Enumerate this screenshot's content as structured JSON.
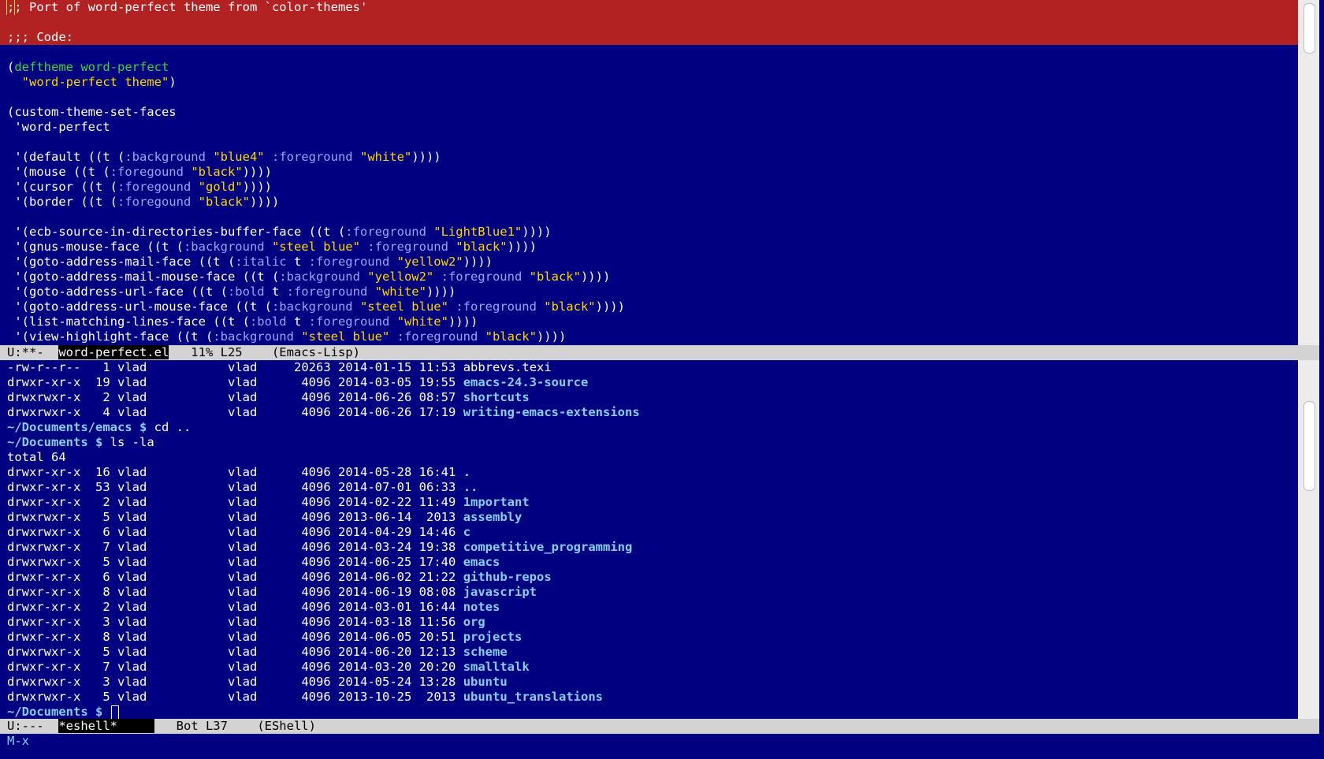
{
  "colors": {
    "background": "#000080",
    "highlight": "#b22222",
    "keyword": "#3cd33c",
    "string": "#ffd700",
    "keyword_arg": "#a0a0ff",
    "directory": "#87cefa",
    "modeline_bg": "#d3d3d3"
  },
  "top_window": {
    "highlighted": [
      [
        {
          "t": ";",
          "c": "cursor"
        },
        {
          "t": "; Port of word-perfect theme from `color-themes'",
          "c": "plain"
        }
      ],
      [],
      [
        {
          "t": ";;; Code:",
          "c": "plain"
        }
      ]
    ],
    "code": [
      [],
      [
        {
          "t": "(",
          "c": "plain"
        },
        {
          "t": "deftheme",
          "c": "kw"
        },
        {
          "t": " ",
          "c": "plain"
        },
        {
          "t": "word-perfect",
          "c": "fn"
        }
      ],
      [
        {
          "t": "  ",
          "c": "plain"
        },
        {
          "t": "\"word-perfect theme\"",
          "c": "str"
        },
        {
          "t": ")",
          "c": "plain"
        }
      ],
      [],
      [
        {
          "t": "(custom-theme-set-faces",
          "c": "plain"
        }
      ],
      [
        {
          "t": " 'word-perfect",
          "c": "plain"
        }
      ],
      [],
      [
        {
          "t": " '(default ((t (",
          "c": "plain"
        },
        {
          "t": ":background",
          "c": "key"
        },
        {
          "t": " ",
          "c": "plain"
        },
        {
          "t": "\"blue4\"",
          "c": "str"
        },
        {
          "t": " ",
          "c": "plain"
        },
        {
          "t": ":foreground",
          "c": "key"
        },
        {
          "t": " ",
          "c": "plain"
        },
        {
          "t": "\"white\"",
          "c": "str"
        },
        {
          "t": "))))",
          "c": "plain"
        }
      ],
      [
        {
          "t": " '(mouse ((t (",
          "c": "plain"
        },
        {
          "t": ":foregound",
          "c": "key"
        },
        {
          "t": " ",
          "c": "plain"
        },
        {
          "t": "\"black\"",
          "c": "str"
        },
        {
          "t": "))))",
          "c": "plain"
        }
      ],
      [
        {
          "t": " '(cursor ((t (",
          "c": "plain"
        },
        {
          "t": ":foregound",
          "c": "key"
        },
        {
          "t": " ",
          "c": "plain"
        },
        {
          "t": "\"gold\"",
          "c": "str"
        },
        {
          "t": "))))",
          "c": "plain"
        }
      ],
      [
        {
          "t": " '(border ((t (",
          "c": "plain"
        },
        {
          "t": ":foregound",
          "c": "key"
        },
        {
          "t": " ",
          "c": "plain"
        },
        {
          "t": "\"black\"",
          "c": "str"
        },
        {
          "t": "))))",
          "c": "plain"
        }
      ],
      [],
      [
        {
          "t": " '(ecb-source-in-directories-buffer-face ((t (",
          "c": "plain"
        },
        {
          "t": ":foreground",
          "c": "key"
        },
        {
          "t": " ",
          "c": "plain"
        },
        {
          "t": "\"LightBlue1\"",
          "c": "str"
        },
        {
          "t": "))))",
          "c": "plain"
        }
      ],
      [
        {
          "t": " '(gnus-mouse-face ((t (",
          "c": "plain"
        },
        {
          "t": ":background",
          "c": "key"
        },
        {
          "t": " ",
          "c": "plain"
        },
        {
          "t": "\"steel blue\"",
          "c": "str"
        },
        {
          "t": " ",
          "c": "plain"
        },
        {
          "t": ":foreground",
          "c": "key"
        },
        {
          "t": " ",
          "c": "plain"
        },
        {
          "t": "\"black\"",
          "c": "str"
        },
        {
          "t": "))))",
          "c": "plain"
        }
      ],
      [
        {
          "t": " '(goto-address-mail-face ((t (",
          "c": "plain"
        },
        {
          "t": ":italic",
          "c": "key"
        },
        {
          "t": " t ",
          "c": "plain"
        },
        {
          "t": ":foreground",
          "c": "key"
        },
        {
          "t": " ",
          "c": "plain"
        },
        {
          "t": "\"yellow2\"",
          "c": "str"
        },
        {
          "t": "))))",
          "c": "plain"
        }
      ],
      [
        {
          "t": " '(goto-address-mail-mouse-face ((t (",
          "c": "plain"
        },
        {
          "t": ":background",
          "c": "key"
        },
        {
          "t": " ",
          "c": "plain"
        },
        {
          "t": "\"yellow2\"",
          "c": "str"
        },
        {
          "t": " ",
          "c": "plain"
        },
        {
          "t": ":foreground",
          "c": "key"
        },
        {
          "t": " ",
          "c": "plain"
        },
        {
          "t": "\"black\"",
          "c": "str"
        },
        {
          "t": "))))",
          "c": "plain"
        }
      ],
      [
        {
          "t": " '(goto-address-url-face ((t (",
          "c": "plain"
        },
        {
          "t": ":bold",
          "c": "key"
        },
        {
          "t": " t ",
          "c": "plain"
        },
        {
          "t": ":foreground",
          "c": "key"
        },
        {
          "t": " ",
          "c": "plain"
        },
        {
          "t": "\"white\"",
          "c": "str"
        },
        {
          "t": "))))",
          "c": "plain"
        }
      ],
      [
        {
          "t": " '(goto-address-url-mouse-face ((t (",
          "c": "plain"
        },
        {
          "t": ":background",
          "c": "key"
        },
        {
          "t": " ",
          "c": "plain"
        },
        {
          "t": "\"steel blue\"",
          "c": "str"
        },
        {
          "t": " ",
          "c": "plain"
        },
        {
          "t": ":foreground",
          "c": "key"
        },
        {
          "t": " ",
          "c": "plain"
        },
        {
          "t": "\"black\"",
          "c": "str"
        },
        {
          "t": "))))",
          "c": "plain"
        }
      ],
      [
        {
          "t": " '(list-matching-lines-face ((t (",
          "c": "plain"
        },
        {
          "t": ":bold",
          "c": "key"
        },
        {
          "t": " t ",
          "c": "plain"
        },
        {
          "t": ":foreground",
          "c": "key"
        },
        {
          "t": " ",
          "c": "plain"
        },
        {
          "t": "\"white\"",
          "c": "str"
        },
        {
          "t": "))))",
          "c": "plain"
        }
      ],
      [
        {
          "t": " '(view-highlight-face ((t (",
          "c": "plain"
        },
        {
          "t": ":background",
          "c": "key"
        },
        {
          "t": " ",
          "c": "plain"
        },
        {
          "t": "\"steel blue\"",
          "c": "str"
        },
        {
          "t": " ",
          "c": "plain"
        },
        {
          "t": ":foreground",
          "c": "key"
        },
        {
          "t": " ",
          "c": "plain"
        },
        {
          "t": "\"black\"",
          "c": "str"
        },
        {
          "t": "))))",
          "c": "plain"
        }
      ]
    ]
  },
  "top_modeline": {
    "status": "U:**-  ",
    "buffer": "word-perfect.el",
    "position": "   11% L25    ",
    "mode": "(Emacs-Lisp)"
  },
  "bottom_window": {
    "lines": [
      {
        "perm": "-rw-r--r--",
        "links": "1",
        "owner": "vlad",
        "group": "vlad",
        "size": "20263",
        "date": "2014-01-15",
        "time": "11:53",
        "name": "abbrevs.texi",
        "is_dir": false
      },
      {
        "perm": "drwxr-xr-x",
        "links": "19",
        "owner": "vlad",
        "group": "vlad",
        "size": "4096",
        "date": "2014-03-05",
        "time": "19:55",
        "name": "emacs-24.3-source",
        "is_dir": true
      },
      {
        "perm": "drwxrwxr-x",
        "links": "2",
        "owner": "vlad",
        "group": "vlad",
        "size": "4096",
        "date": "2014-06-26",
        "time": "08:57",
        "name": "shortcuts",
        "is_dir": true
      },
      {
        "perm": "drwxrwxr-x",
        "links": "4",
        "owner": "vlad",
        "group": "vlad",
        "size": "4096",
        "date": "2014-06-26",
        "time": "17:19",
        "name": "writing-emacs-extensions",
        "is_dir": true
      }
    ],
    "cmd1_prompt": "~/Documents/emacs $ ",
    "cmd1": "cd ..",
    "cmd2_prompt": "~/Documents $ ",
    "cmd2": "ls -la",
    "total": "total 64",
    "listing": [
      {
        "perm": "drwxr-xr-x",
        "links": "16",
        "owner": "vlad",
        "group": "vlad",
        "size": "4096",
        "date": "2014-05-28",
        "time": "16:41",
        "name": ".",
        "is_dir": true
      },
      {
        "perm": "drwxr-xr-x",
        "links": "53",
        "owner": "vlad",
        "group": "vlad",
        "size": "4096",
        "date": "2014-07-01",
        "time": "06:33",
        "name": "..",
        "is_dir": true
      },
      {
        "perm": "drwxr-xr-x",
        "links": "2",
        "owner": "vlad",
        "group": "vlad",
        "size": "4096",
        "date": "2014-02-22",
        "time": "11:49",
        "name": "1mportant",
        "is_dir": true
      },
      {
        "perm": "drwxrwxr-x",
        "links": "5",
        "owner": "vlad",
        "group": "vlad",
        "size": "4096",
        "date": "2013-06-14",
        "time": " 2013",
        "name": "assembly",
        "is_dir": true
      },
      {
        "perm": "drwxrwxr-x",
        "links": "6",
        "owner": "vlad",
        "group": "vlad",
        "size": "4096",
        "date": "2014-04-29",
        "time": "14:46",
        "name": "c",
        "is_dir": true
      },
      {
        "perm": "drwxrwxr-x",
        "links": "7",
        "owner": "vlad",
        "group": "vlad",
        "size": "4096",
        "date": "2014-03-24",
        "time": "19:38",
        "name": "competitive_programming",
        "is_dir": true
      },
      {
        "perm": "drwxrwxr-x",
        "links": "5",
        "owner": "vlad",
        "group": "vlad",
        "size": "4096",
        "date": "2014-06-25",
        "time": "17:40",
        "name": "emacs",
        "is_dir": true
      },
      {
        "perm": "drwxr-xr-x",
        "links": "6",
        "owner": "vlad",
        "group": "vlad",
        "size": "4096",
        "date": "2014-06-02",
        "time": "21:22",
        "name": "github-repos",
        "is_dir": true
      },
      {
        "perm": "drwxr-xr-x",
        "links": "8",
        "owner": "vlad",
        "group": "vlad",
        "size": "4096",
        "date": "2014-06-19",
        "time": "08:08",
        "name": "javascript",
        "is_dir": true
      },
      {
        "perm": "drwxr-xr-x",
        "links": "2",
        "owner": "vlad",
        "group": "vlad",
        "size": "4096",
        "date": "2014-03-01",
        "time": "16:44",
        "name": "notes",
        "is_dir": true
      },
      {
        "perm": "drwxr-xr-x",
        "links": "3",
        "owner": "vlad",
        "group": "vlad",
        "size": "4096",
        "date": "2014-03-18",
        "time": "11:56",
        "name": "org",
        "is_dir": true
      },
      {
        "perm": "drwxr-xr-x",
        "links": "8",
        "owner": "vlad",
        "group": "vlad",
        "size": "4096",
        "date": "2014-06-05",
        "time": "20:51",
        "name": "projects",
        "is_dir": true
      },
      {
        "perm": "drwxrwxr-x",
        "links": "5",
        "owner": "vlad",
        "group": "vlad",
        "size": "4096",
        "date": "2014-06-20",
        "time": "12:13",
        "name": "scheme",
        "is_dir": true
      },
      {
        "perm": "drwxr-xr-x",
        "links": "7",
        "owner": "vlad",
        "group": "vlad",
        "size": "4096",
        "date": "2014-03-20",
        "time": "20:20",
        "name": "smalltalk",
        "is_dir": true
      },
      {
        "perm": "drwxrwxr-x",
        "links": "3",
        "owner": "vlad",
        "group": "vlad",
        "size": "4096",
        "date": "2014-05-24",
        "time": "13:28",
        "name": "ubuntu",
        "is_dir": true
      },
      {
        "perm": "drwxrwxr-x",
        "links": "5",
        "owner": "vlad",
        "group": "vlad",
        "size": "4096",
        "date": "2013-10-25",
        "time": " 2013",
        "name": "ubuntu_translations",
        "is_dir": true
      }
    ],
    "final_prompt": "~/Documents $ "
  },
  "bottom_modeline": {
    "status": "U:---  ",
    "buffer": "*eshell*     ",
    "position": "   Bot L37    ",
    "mode": "(EShell)"
  },
  "minibuffer": {
    "text": "M-x"
  }
}
